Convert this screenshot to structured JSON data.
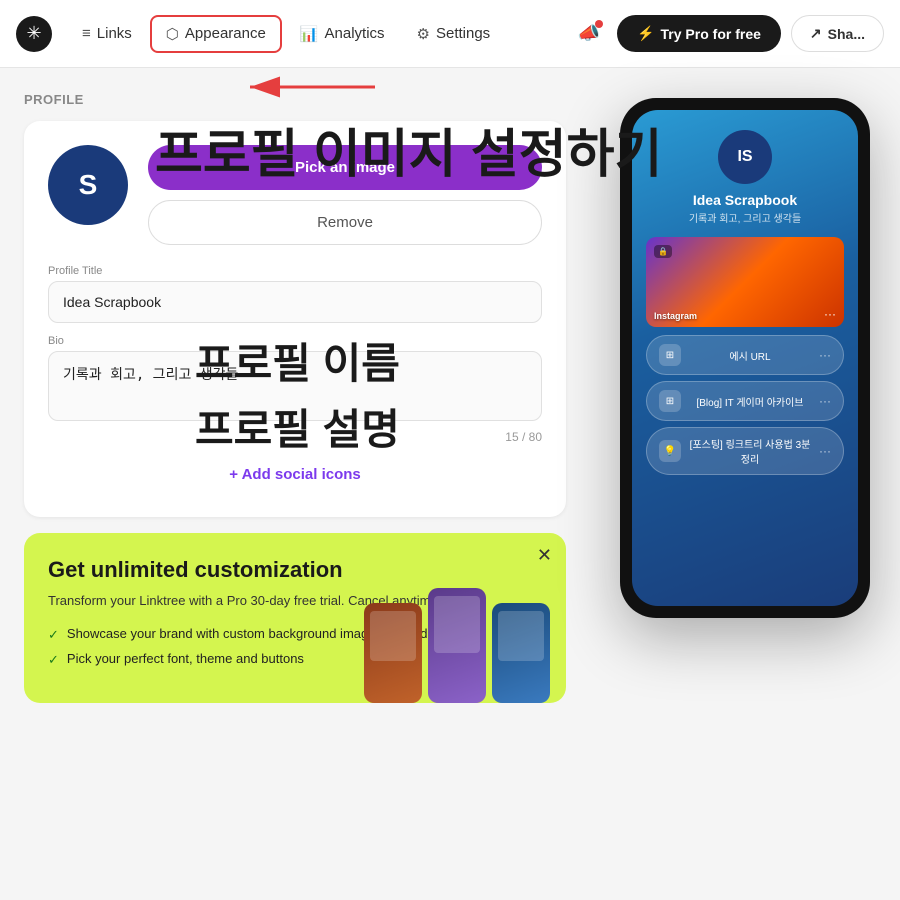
{
  "header": {
    "logo_symbol": "✳",
    "nav": [
      {
        "id": "links",
        "label": "Links",
        "icon": "≡",
        "active": false
      },
      {
        "id": "appearance",
        "label": "Appearance",
        "icon": "⬡",
        "active": true
      },
      {
        "id": "analytics",
        "label": "Analytics",
        "icon": "📊",
        "active": false
      },
      {
        "id": "settings",
        "label": "Settings",
        "icon": "⚙",
        "active": false
      }
    ],
    "try_pro_label": "Try Pro for free",
    "share_label": "Sha..."
  },
  "profile": {
    "section_label": "Profile",
    "avatar_initials": "S",
    "pick_image_label": "Pick an image",
    "remove_label": "Remove",
    "title_field": {
      "label": "Profile Title",
      "value": "Idea Scrapbook",
      "placeholder": "Idea Scrapbook"
    },
    "bio_field": {
      "label": "Bio",
      "value": "기록과 회고, 그리고 생각들",
      "placeholder": "기록과 회고, 그리고 생각들",
      "char_count": "15 / 80"
    },
    "add_social_label": "+ Add social icons"
  },
  "promo": {
    "title": "Get unlimited customization",
    "subtitle": "Transform your Linktree with a Pro 30-day free trial. Cancel anytime.",
    "features": [
      "Showcase your brand with custom background images and videos",
      "Pick your perfect font, theme and buttons"
    ],
    "close_label": "✕"
  },
  "phone_preview": {
    "avatar_initials": "IS",
    "name": "Idea Scrapbook",
    "bio": "기록과 회고, 그리고 생각들",
    "banner_label": "Instagram",
    "links": [
      {
        "text": "에시 URL"
      },
      {
        "text": "[Blog] IT 게이머 아카이브"
      },
      {
        "text": "[포스팅] 링크트리 사용법 3분정리"
      }
    ]
  },
  "korean": {
    "heading1": "프로필 이미지 설정하기",
    "heading2": "프로필 이름",
    "heading3": "프로필 설명"
  }
}
